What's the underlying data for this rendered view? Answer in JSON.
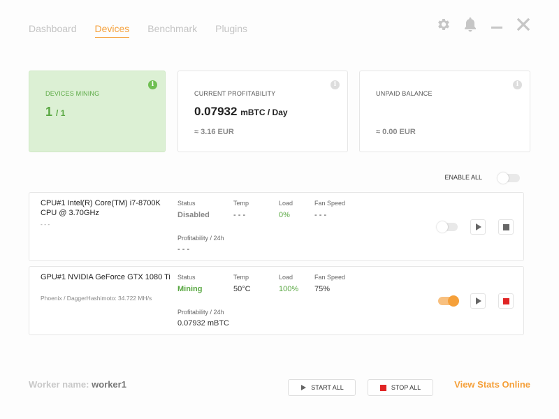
{
  "nav": {
    "tabs": [
      {
        "label": "Dashboard"
      },
      {
        "label": "Devices"
      },
      {
        "label": "Benchmark"
      },
      {
        "label": "Plugins"
      }
    ],
    "active": "Devices"
  },
  "window_icons": [
    "gear-icon",
    "bell-icon",
    "minimize-icon",
    "close-icon"
  ],
  "cards": {
    "devices_mining": {
      "label": "DEVICES MINING",
      "active": "1",
      "total": "/ 1",
      "info": "i"
    },
    "current_profitability": {
      "label": "CURRENT PROFITABILITY",
      "value": "0.07932",
      "unit": "mBTC / Day",
      "fiat": "≈ 3.16 EUR",
      "info": "i"
    },
    "unpaid_balance": {
      "label": "UNPAID BALANCE",
      "fiat": "≈ 0.00 EUR",
      "info": "i"
    }
  },
  "enable_all": {
    "label": "ENABLE ALL",
    "on": false
  },
  "columns": {
    "status": "Status",
    "temp": "Temp",
    "load": "Load",
    "fan": "Fan Speed",
    "profit": "Profitability / 24h"
  },
  "devices": [
    {
      "name": "CPU#1 Intel(R) Core(TM) i7-8700K CPU @ 3.70GHz",
      "algo": "- - -",
      "status": "Disabled",
      "temp": "- - -",
      "load": "0%",
      "fan": "- - -",
      "profit": "- - -",
      "enabled": false
    },
    {
      "name": "GPU#1 NVIDIA GeForce GTX 1080 Ti",
      "algo": "Phoenix / DaggerHashimoto: 34.722 MH/s",
      "status": "Mining",
      "temp": "50°C",
      "load": "100%",
      "fan": "75%",
      "profit": "0.07932 mBTC",
      "enabled": true
    }
  ],
  "footer": {
    "worker_label": "Worker name:",
    "worker_name": "worker1",
    "start_all": "START ALL",
    "stop_all": "STOP ALL",
    "view_stats": "View Stats Online"
  },
  "colors": {
    "accent": "#f5a03a",
    "green": "#5aa843",
    "red": "#e02424",
    "card_green_bg": "#dcf0d4"
  }
}
